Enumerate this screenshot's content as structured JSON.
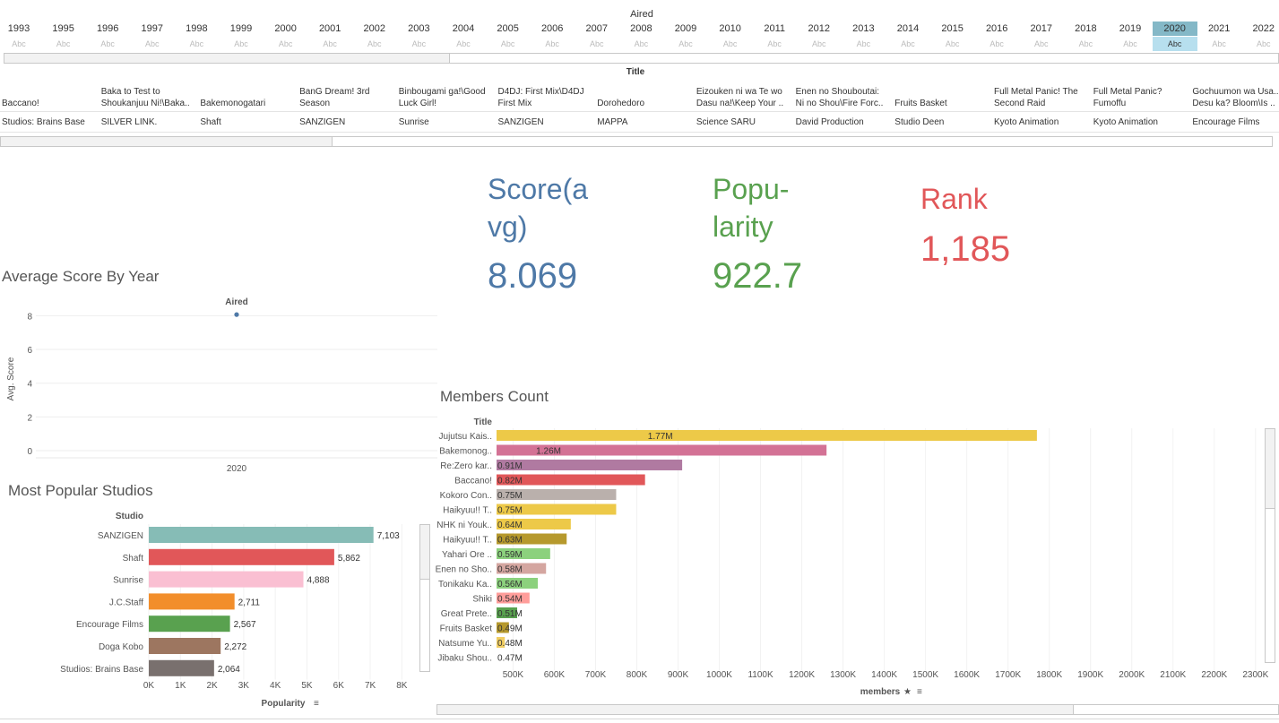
{
  "aired_header": "Aired",
  "years": [
    "1993",
    "1995",
    "1996",
    "1997",
    "1998",
    "1999",
    "2000",
    "2001",
    "2002",
    "2003",
    "2004",
    "2005",
    "2006",
    "2007",
    "2008",
    "2009",
    "2010",
    "2011",
    "2012",
    "2013",
    "2014",
    "2015",
    "2016",
    "2017",
    "2018",
    "2019",
    "2020",
    "2021",
    "2022"
  ],
  "selected_year": "2020",
  "abc": "Abc",
  "title_header": "Title",
  "titles": [
    {
      "title": "Baccano!",
      "studio": "Studios: Brains Base"
    },
    {
      "title": "Baka to Test to Shoukanjuu Ni!\\Baka..",
      "studio": "SILVER LINK."
    },
    {
      "title": "Bakemonogatari",
      "studio": "Shaft"
    },
    {
      "title": "BanG Dream! 3rd Season",
      "studio": "SANZIGEN"
    },
    {
      "title": "Binbougami ga!\\Good Luck Girl!",
      "studio": "Sunrise"
    },
    {
      "title": "D4DJ: First Mix\\D4DJ First Mix",
      "studio": "SANZIGEN"
    },
    {
      "title": "Dorohedoro",
      "studio": "MAPPA"
    },
    {
      "title": "Eizouken ni wa Te wo Dasu na!\\Keep Your ..",
      "studio": "Science SARU"
    },
    {
      "title": "Enen no Shouboutai: Ni no Shou\\Fire Forc..",
      "studio": "David Production"
    },
    {
      "title": "Fruits Basket",
      "studio": "Studio Deen"
    },
    {
      "title": "Full Metal Panic! The Second Raid",
      "studio": "Kyoto Animation"
    },
    {
      "title": "Full Metal Panic? Fumoffu",
      "studio": "Kyoto Animation"
    },
    {
      "title": "Gochuumon wa Usa.. Desu ka? Bloom\\Is ..",
      "studio": "Encourage Films"
    }
  ],
  "kpis": {
    "score_label": "Score(a vg)",
    "score_label_l1": "Score(a",
    "score_label_l2": "vg)",
    "score_value": "8.069",
    "popularity_label_l1": "Popu-",
    "popularity_label_l2": "larity",
    "popularity_value": "922.7",
    "rank_label": "Rank",
    "rank_value": "1,185",
    "score_color": "#4e79a7",
    "popularity_color": "#59a14f",
    "rank_color": "#e15759"
  },
  "avg_score_panel": {
    "title": "Average Score By Year",
    "header": "Aired",
    "ylabel": "Avg. Score"
  },
  "studios_panel": {
    "title": "Most Popular Studios",
    "header": "Studio",
    "xlabel": "Popularity"
  },
  "members_panel": {
    "title": "Members Count",
    "header": "Title",
    "xlabel": "members"
  },
  "chart_data": [
    {
      "type": "scatter",
      "title": "Average Score By Year",
      "xlabel": "",
      "ylabel": "Avg. Score",
      "x": [
        "2020"
      ],
      "y": [
        8.069
      ],
      "ylim": [
        0,
        8.5
      ],
      "yticks": [
        0,
        2,
        4,
        6,
        8
      ],
      "grid": true
    },
    {
      "type": "bar",
      "orientation": "horizontal",
      "title": "Most Popular Studios",
      "xlabel": "Popularity",
      "ylabel": "Studio",
      "categories": [
        "SANZIGEN",
        "Shaft",
        "Sunrise",
        "J.C.Staff",
        "Encourage Films",
        "Doga Kobo",
        "Studios: Brains Base"
      ],
      "values": [
        7103,
        5862,
        4888,
        2711,
        2567,
        2272,
        2064
      ],
      "value_labels": [
        "7,103",
        "5,862",
        "4,888",
        "2,711",
        "2,567",
        "2,272",
        "2,064"
      ],
      "colors": [
        "#86bcb6",
        "#e15759",
        "#fabfd2",
        "#f28e2b",
        "#59a14f",
        "#9d7660",
        "#79706e"
      ],
      "xlim": [
        0,
        8500
      ],
      "xticks": [
        0,
        1000,
        2000,
        3000,
        4000,
        5000,
        6000,
        7000,
        8000
      ],
      "xtick_labels": [
        "0K",
        "1K",
        "2K",
        "3K",
        "4K",
        "5K",
        "6K",
        "7K",
        "8K"
      ]
    },
    {
      "type": "bar",
      "orientation": "horizontal",
      "title": "Members Count",
      "xlabel": "members",
      "ylabel": "Title",
      "categories": [
        "Jujutsu Kais..",
        "Bakemonog..",
        "Re:Zero kar..",
        "Baccano!",
        "Kokoro Con..",
        "Haikyuu!! T..",
        "NHK ni Youk..",
        "Haikyuu!! T..",
        "Yahari Ore ..",
        "Enen no Sho..",
        "Tonikaku Ka..",
        "Shiki",
        "Great Prete..",
        "Fruits Basket",
        "Natsume Yu..",
        "Jibaku Shou.."
      ],
      "values": [
        1770000,
        1260000,
        910000,
        820000,
        750000,
        750000,
        640000,
        630000,
        590000,
        580000,
        560000,
        540000,
        510000,
        490000,
        480000,
        470000
      ],
      "value_labels": [
        "1.77M",
        "1.26M",
        "0.91M",
        "0.82M",
        "0.75M",
        "0.75M",
        "0.64M",
        "0.63M",
        "0.59M",
        "0.58M",
        "0.56M",
        "0.54M",
        "0.51M",
        "0.49M",
        "0.48M",
        "0.47M"
      ],
      "colors": [
        "#edc948",
        "#d37295",
        "#b07aa1",
        "#e15759",
        "#bab0ac",
        "#edc948",
        "#edc948",
        "#b6992d",
        "#8cd17d",
        "#d4a6a0",
        "#8cd17d",
        "#ff9d9a",
        "#59a14f",
        "#b6992d",
        "#f1ce63",
        "#ffffff"
      ],
      "xlim": [
        460000,
        2320000
      ],
      "xticks": [
        500000,
        600000,
        700000,
        800000,
        900000,
        1000000,
        1100000,
        1200000,
        1300000,
        1400000,
        1500000,
        1600000,
        1700000,
        1800000,
        1900000,
        2000000,
        2100000,
        2200000,
        2300000
      ],
      "xtick_labels": [
        "500K",
        "600K",
        "700K",
        "800K",
        "900K",
        "1000K",
        "1100K",
        "1200K",
        "1300K",
        "1400K",
        "1500K",
        "1600K",
        "1700K",
        "1800K",
        "1900K",
        "2000K",
        "2100K",
        "2200K",
        "2300K"
      ]
    }
  ]
}
